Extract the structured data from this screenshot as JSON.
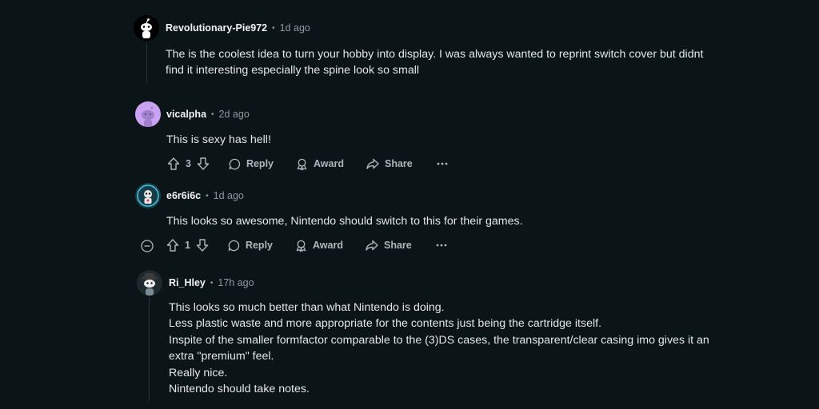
{
  "comments": [
    {
      "username": "Revolutionary-Pie972",
      "time": "1d ago",
      "avatar": "snoo-avatar",
      "lines": [
        "The is the coolest idea to turn your hobby into display. I was always wanted to reprint switch cover but didnt",
        "find it interesting especially the spine look so small"
      ]
    },
    {
      "username": "vicalpha",
      "time": "2d ago",
      "avatar": "purple-snoo-avatar",
      "lines": [
        "This is sexy has hell!"
      ],
      "votes": "3",
      "reply": "Reply",
      "award": "Award",
      "share": "Share"
    },
    {
      "username": "e6r6i6c",
      "time": "1d ago",
      "avatar": "robot-avatar",
      "lines": [
        "This looks so awesome, Nintendo should switch to this for their games."
      ],
      "votes": "1",
      "reply": "Reply",
      "award": "Award",
      "share": "Share"
    },
    {
      "username": "Ri_Hley",
      "time": "17h ago",
      "avatar": "hat-snoo-avatar",
      "lines": [
        "This looks so much better than what Nintendo is doing.",
        "Less plastic waste and more appropriate for the contents just being the cartridge itself.",
        "Inspite of the smaller formfactor comparable to the (3)DS cases, the transparent/clear casing imo gives it an",
        "extra \"premium\" feel.",
        "Really nice.",
        "Nintendo should take notes."
      ]
    }
  ],
  "colors": {
    "background": "#0b1416",
    "thread_line": "#2a3236",
    "meta": "#8b9aa3",
    "actions": "#aeb7bd"
  }
}
